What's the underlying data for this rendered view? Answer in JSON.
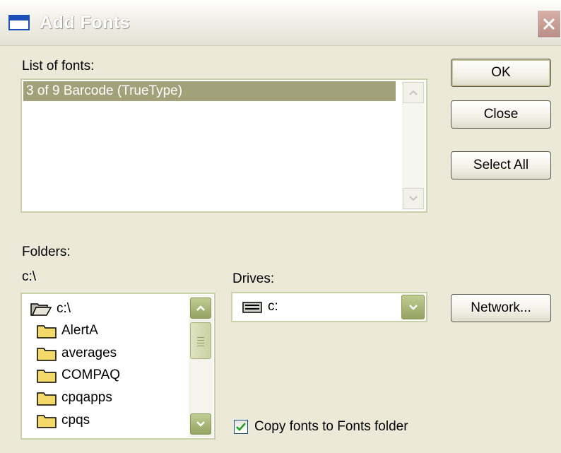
{
  "window": {
    "title": "Add Fonts",
    "accent_color": "#a3a17a",
    "scroll_button_color": "#a5b173"
  },
  "font_list": {
    "label": "List of fonts:",
    "items": [
      "3 of 9 Barcode (TrueType)"
    ],
    "selected_index": 0
  },
  "folders": {
    "label": "Folders:",
    "current_path": "c:\\",
    "items": [
      {
        "name": "c:\\",
        "icon": "open-folder-icon"
      },
      {
        "name": "AlertA",
        "icon": "folder-icon"
      },
      {
        "name": "averages",
        "icon": "folder-icon"
      },
      {
        "name": "COMPAQ",
        "icon": "folder-icon"
      },
      {
        "name": "cpqapps",
        "icon": "folder-icon"
      },
      {
        "name": "cpqs",
        "icon": "folder-icon"
      }
    ]
  },
  "drives": {
    "label": "Drives:",
    "selected": "c:",
    "icon": "hard-drive-icon"
  },
  "buttons": {
    "ok": "OK",
    "close": "Close",
    "select_all": "Select All",
    "network": "Network..."
  },
  "copy_option": {
    "label": "Copy fonts to Fonts folder",
    "checked": true
  }
}
